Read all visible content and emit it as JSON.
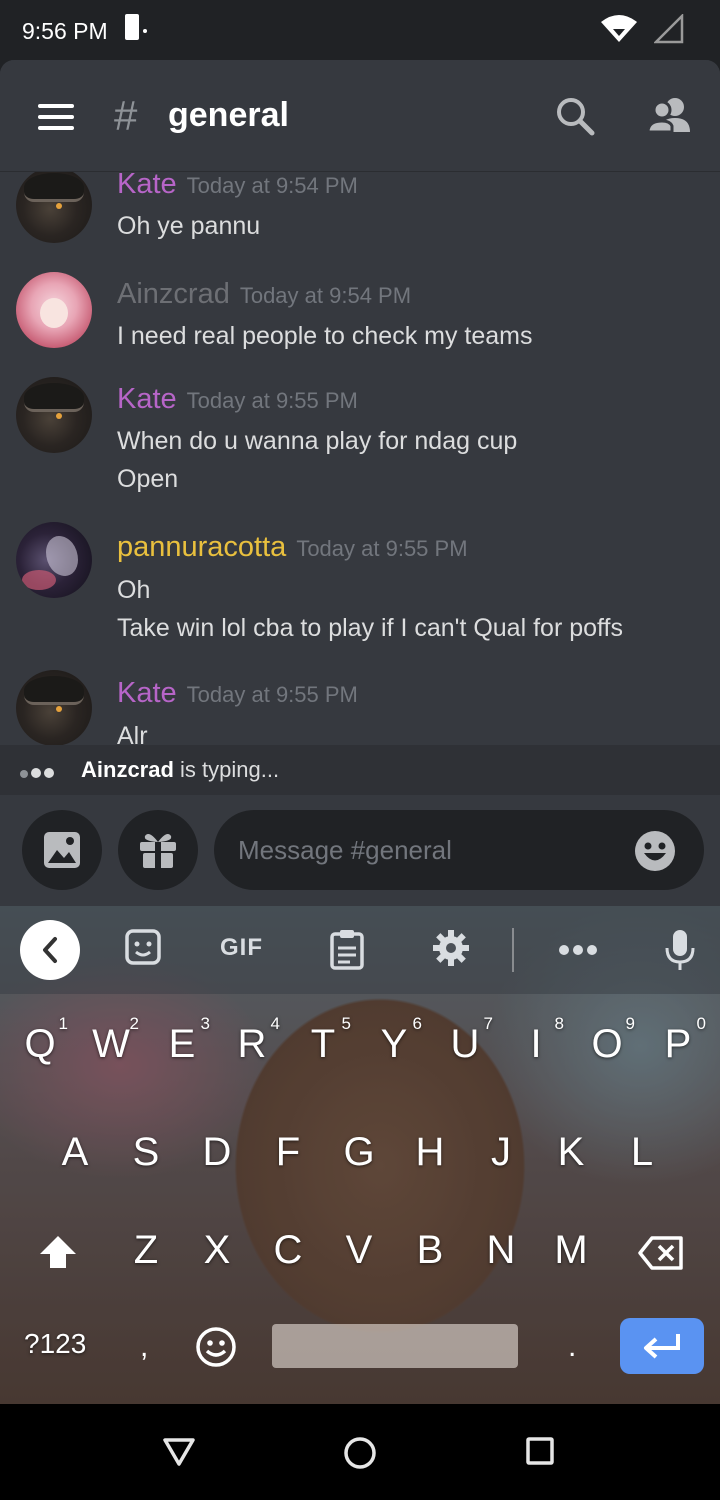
{
  "status_bar": {
    "time": "9:56 PM"
  },
  "header": {
    "hash": "#",
    "channel": "general"
  },
  "messages": [
    {
      "author": "Kate",
      "color": "#b765c8",
      "timestamp": "Today at 9:54 PM",
      "lines": [
        "Oh ye pannu"
      ]
    },
    {
      "author": "Ainzcrad",
      "color": "#6d6f74",
      "timestamp": "Today at 9:54 PM",
      "lines": [
        "I need real people to check my teams"
      ]
    },
    {
      "author": "Kate",
      "color": "#b765c8",
      "timestamp": "Today at 9:55 PM",
      "lines": [
        "When do u wanna play for ndag cup",
        "Open"
      ]
    },
    {
      "author": "pannuracotta",
      "color": "#e9c03e",
      "timestamp": "Today at 9:55 PM",
      "lines": [
        "Oh",
        "Take win lol cba to play if I can't Qual for poffs"
      ]
    },
    {
      "author": "Kate",
      "color": "#b765c8",
      "timestamp": "Today at 9:55 PM",
      "lines": [
        "Alr"
      ]
    }
  ],
  "typing": {
    "user": "Ainzcrad",
    "text": " is typing..."
  },
  "composer": {
    "placeholder": "Message #general"
  },
  "keyboard": {
    "toolbar_gif": "GIF",
    "row1": [
      {
        "k": "Q",
        "n": "1"
      },
      {
        "k": "W",
        "n": "2"
      },
      {
        "k": "E",
        "n": "3"
      },
      {
        "k": "R",
        "n": "4"
      },
      {
        "k": "T",
        "n": "5"
      },
      {
        "k": "Y",
        "n": "6"
      },
      {
        "k": "U",
        "n": "7"
      },
      {
        "k": "I",
        "n": "8"
      },
      {
        "k": "O",
        "n": "9"
      },
      {
        "k": "P",
        "n": "0"
      }
    ],
    "row2": [
      "A",
      "S",
      "D",
      "F",
      "G",
      "H",
      "J",
      "K",
      "L"
    ],
    "row3": [
      "Z",
      "X",
      "C",
      "V",
      "B",
      "N",
      "M"
    ],
    "symbols": "?123",
    "comma": ",",
    "period": "."
  }
}
